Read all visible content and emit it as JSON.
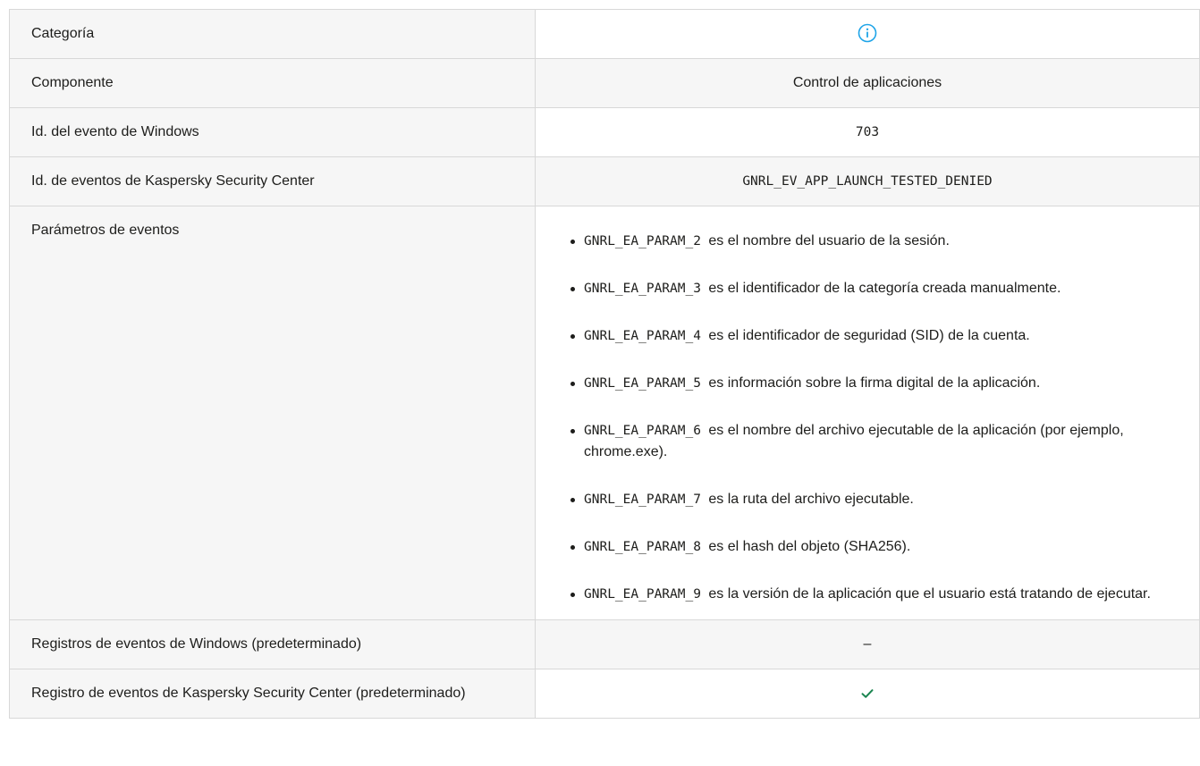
{
  "rows": {
    "category": {
      "label": "Categoría",
      "icon": "info-icon",
      "icon_color": "#1ea4e8"
    },
    "component": {
      "label": "Componente",
      "value": "Control de aplicaciones"
    },
    "windows_event_id": {
      "label": "Id. del evento de Windows",
      "value": "703"
    },
    "ksc_event_id": {
      "label": "Id. de eventos de Kaspersky Security Center",
      "value": "GNRL_EV_APP_LAUNCH_TESTED_DENIED"
    },
    "event_params": {
      "label": "Parámetros de eventos",
      "items": [
        {
          "code": "GNRL_EA_PARAM_2",
          "text": "es el nombre del usuario de la sesión."
        },
        {
          "code": "GNRL_EA_PARAM_3",
          "text": "es el identificador de la categoría creada manualmente."
        },
        {
          "code": "GNRL_EA_PARAM_4",
          "text": "es el identificador de seguridad (SID) de la cuenta."
        },
        {
          "code": "GNRL_EA_PARAM_5",
          "text": "es información sobre la firma digital de la aplicación."
        },
        {
          "code": "GNRL_EA_PARAM_6",
          "text": "es el nombre del archivo ejecutable de la aplicación (por ejemplo, chrome.exe)."
        },
        {
          "code": "GNRL_EA_PARAM_7",
          "text": "es la ruta del archivo ejecutable."
        },
        {
          "code": "GNRL_EA_PARAM_8",
          "text": "es el hash del objeto (SHA256)."
        },
        {
          "code": "GNRL_EA_PARAM_9",
          "text": "es la versión de la aplicación que el usuario está tratando de ejecutar."
        }
      ]
    },
    "windows_log": {
      "label": "Registros de eventos de Windows (predeterminado)",
      "value": "–"
    },
    "ksc_log": {
      "label": "Registro de eventos de Kaspersky Security Center (predeterminado)",
      "icon": "check-icon",
      "icon_color": "#19844f"
    }
  }
}
